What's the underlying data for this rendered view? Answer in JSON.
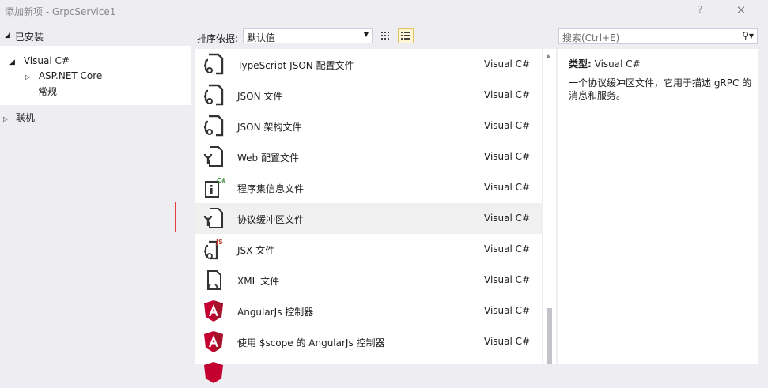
{
  "window": {
    "title": "添加新项 - GrpcService1",
    "help_label": "?",
    "close_label": "✕"
  },
  "tree": {
    "installed_label": "已安装",
    "items": [
      {
        "label": "Visual C#",
        "expanded": true
      },
      {
        "label": "ASP.NET Core",
        "expanded": false
      },
      {
        "label": "常规"
      }
    ],
    "online_label": "联机"
  },
  "toolbar": {
    "sort_label": "排序依据:",
    "sort_value": "默认值",
    "search_placeholder": "搜索(Ctrl+E)",
    "search_icon": "search-icon"
  },
  "templates": [
    {
      "name": "TypeScript JSON 配置文件",
      "lang": "Visual C#",
      "icon": "json-file-icon"
    },
    {
      "name": "JSON 文件",
      "lang": "Visual C#",
      "icon": "json-file-icon"
    },
    {
      "name": "JSON 架构文件",
      "lang": "Visual C#",
      "icon": "json-schema-file-icon"
    },
    {
      "name": "Web 配置文件",
      "lang": "Visual C#",
      "icon": "config-file-icon"
    },
    {
      "name": "程序集信息文件",
      "lang": "Visual C#",
      "icon": "assembly-info-icon"
    },
    {
      "name": "协议缓冲区文件",
      "lang": "Visual C#",
      "icon": "protobuf-file-icon",
      "selected": true
    },
    {
      "name": "JSX 文件",
      "lang": "Visual C#",
      "icon": "jsx-file-icon"
    },
    {
      "name": "XML 文件",
      "lang": "Visual C#",
      "icon": "xml-file-icon"
    },
    {
      "name": "AngularJs 控制器",
      "lang": "Visual C#",
      "icon": "angularjs-icon"
    },
    {
      "name": "使用 $scope 的 AngularJs 控制器",
      "lang": "Visual C#",
      "icon": "angularjs-icon"
    }
  ],
  "details": {
    "type_label": "类型:",
    "type_value": "Visual C#",
    "description": "一个协议缓冲区文件，它用于描述 gRPC 的消息和服务。"
  },
  "colors": {
    "highlight_border": "#e53d3d",
    "angular_red": "#c3002f",
    "selected_row": "#f0f0f0"
  }
}
